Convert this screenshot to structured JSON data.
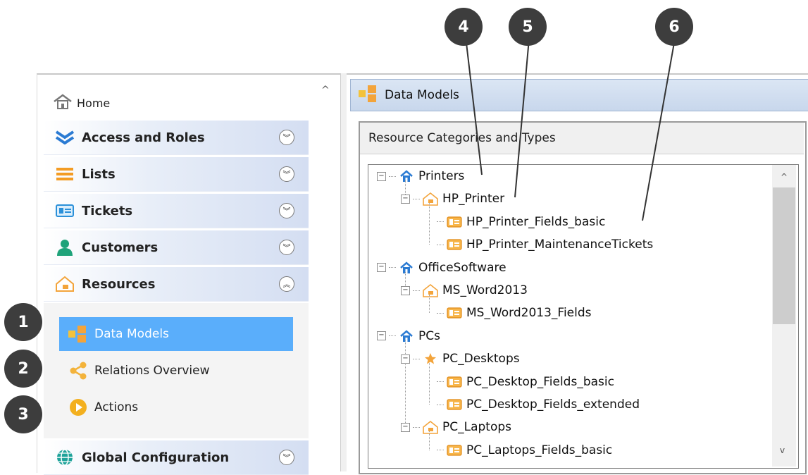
{
  "nav": {
    "home_label": "Home",
    "sections": [
      {
        "label": "Access and Roles",
        "expanded": false
      },
      {
        "label": "Lists",
        "expanded": false
      },
      {
        "label": "Tickets",
        "expanded": false
      },
      {
        "label": "Customers",
        "expanded": false
      },
      {
        "label": "Resources",
        "expanded": true
      },
      {
        "label": "Global Configuration",
        "expanded": false
      }
    ],
    "resources_items": [
      {
        "label": "Data Models",
        "selected": true
      },
      {
        "label": "Relations Overview",
        "selected": false
      },
      {
        "label": "Actions",
        "selected": false
      }
    ]
  },
  "content": {
    "header_title": "Data Models",
    "group_title": "Resource Categories and Types",
    "tree": [
      {
        "label": "Printers",
        "level": 0,
        "icon": "house-icon"
      },
      {
        "label": "HP_Printer",
        "level": 1,
        "icon": "resource-type-icon"
      },
      {
        "label": "HP_Printer_Fields_basic",
        "level": 2,
        "icon": "field-set-icon"
      },
      {
        "label": "HP_Printer_MaintenanceTickets",
        "level": 2,
        "icon": "field-set-icon"
      },
      {
        "label": "OfficeSoftware",
        "level": 0,
        "icon": "house-icon"
      },
      {
        "label": "MS_Word2013",
        "level": 1,
        "icon": "resource-type-icon"
      },
      {
        "label": "MS_Word2013_Fields",
        "level": 2,
        "icon": "field-set-icon"
      },
      {
        "label": "PCs",
        "level": 0,
        "icon": "house-icon"
      },
      {
        "label": "PC_Desktops",
        "level": 1,
        "icon": "star-icon"
      },
      {
        "label": "PC_Desktop_Fields_basic",
        "level": 2,
        "icon": "field-set-icon"
      },
      {
        "label": "PC_Desktop_Fields_extended",
        "level": 2,
        "icon": "field-set-icon"
      },
      {
        "label": "PC_Laptops",
        "level": 1,
        "icon": "resource-type-icon"
      },
      {
        "label": "PC_Laptops_Fields_basic",
        "level": 2,
        "icon": "field-set-icon"
      }
    ]
  },
  "callouts": [
    "1",
    "2",
    "3",
    "4",
    "5",
    "6"
  ],
  "colors": {
    "selection": "#5aaefb",
    "callout": "#3d3d3d",
    "icon_orange": "#f3a43b",
    "icon_blue": "#2b7bd3"
  }
}
